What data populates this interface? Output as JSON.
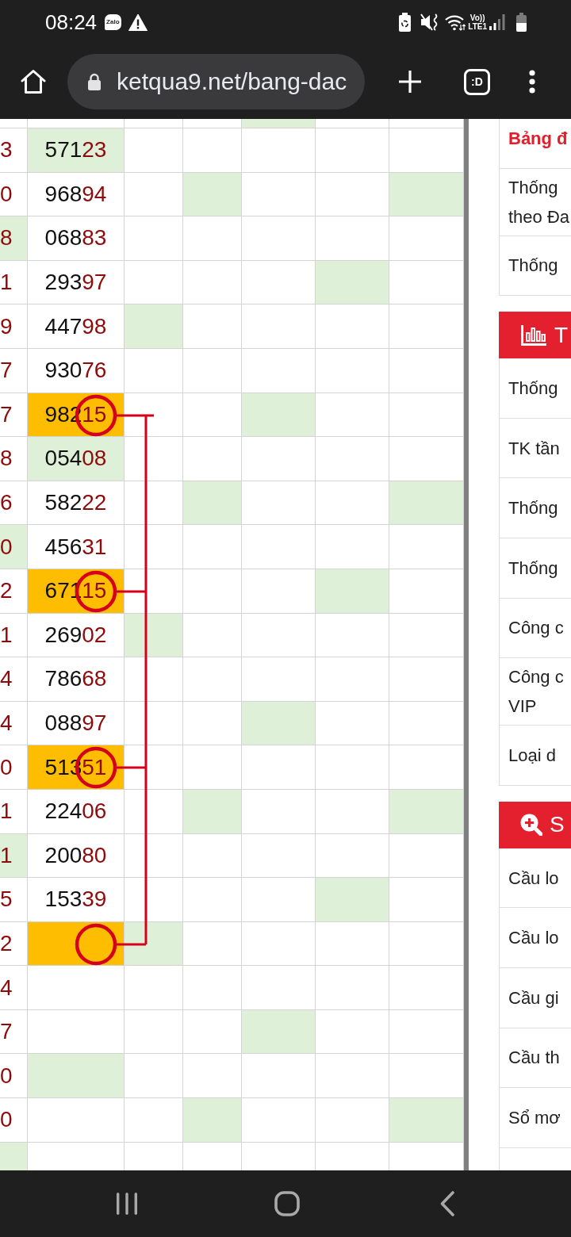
{
  "status_bar": {
    "time": "08:24",
    "notifications": [
      {
        "label": "Zalo"
      }
    ],
    "network": {
      "volte": "Vo))",
      "type": "LTE1"
    }
  },
  "browser": {
    "url": "ketqua9.net/bang-dac",
    "tab_count": ":D"
  },
  "table": {
    "rows": [
      {
        "digit_marked": false,
        "number": {
          "marked": false,
          "highlighted": false
        },
        "circled": false,
        "cells": [
          {
            "marked": false
          },
          {
            "marked": false
          },
          {
            "marked": true
          },
          {
            "marked": false
          },
          {
            "marked": false
          }
        ]
      },
      {
        "digit": "3",
        "digit_marked": false,
        "number": {
          "lead": "571",
          "tail": "23",
          "marked": true,
          "highlighted": false
        },
        "circled": false,
        "cells": [
          {
            "marked": false
          },
          {
            "marked": false
          },
          {
            "marked": false
          },
          {
            "marked": false
          },
          {
            "marked": false
          }
        ]
      },
      {
        "digit": "0",
        "digit_marked": false,
        "number": {
          "lead": "968",
          "tail": "94",
          "marked": false,
          "highlighted": false
        },
        "circled": false,
        "cells": [
          {
            "marked": false
          },
          {
            "marked": true
          },
          {
            "marked": false
          },
          {
            "marked": false
          },
          {
            "marked": true
          }
        ]
      },
      {
        "digit": "8",
        "digit_marked": true,
        "number": {
          "lead": "068",
          "tail": "83",
          "marked": false,
          "highlighted": false
        },
        "circled": false,
        "cells": [
          {
            "marked": false
          },
          {
            "marked": false
          },
          {
            "marked": false
          },
          {
            "marked": false
          },
          {
            "marked": false
          }
        ]
      },
      {
        "digit": "1",
        "digit_marked": false,
        "number": {
          "lead": "293",
          "tail": "97",
          "marked": false,
          "highlighted": false
        },
        "circled": false,
        "cells": [
          {
            "marked": false
          },
          {
            "marked": false
          },
          {
            "marked": false
          },
          {
            "marked": true
          },
          {
            "marked": false
          }
        ]
      },
      {
        "digit": "9",
        "digit_marked": false,
        "number": {
          "lead": "447",
          "tail": "98",
          "marked": false,
          "highlighted": false
        },
        "circled": false,
        "cells": [
          {
            "marked": true
          },
          {
            "marked": false
          },
          {
            "marked": false
          },
          {
            "marked": false
          },
          {
            "marked": false
          }
        ]
      },
      {
        "digit": "7",
        "digit_marked": false,
        "number": {
          "lead": "930",
          "tail": "76",
          "marked": false,
          "highlighted": false
        },
        "circled": false,
        "cells": [
          {
            "marked": false
          },
          {
            "marked": false
          },
          {
            "marked": false
          },
          {
            "marked": false
          },
          {
            "marked": false
          }
        ]
      },
      {
        "digit": "7",
        "digit_marked": false,
        "number": {
          "lead": "982",
          "tail": "15",
          "marked": false,
          "highlighted": true
        },
        "circled": true,
        "cells": [
          {
            "marked": false
          },
          {
            "marked": false
          },
          {
            "marked": true
          },
          {
            "marked": false
          },
          {
            "marked": false
          }
        ]
      },
      {
        "digit": "8",
        "digit_marked": false,
        "number": {
          "lead": "054",
          "tail": "08",
          "marked": true,
          "highlighted": false
        },
        "circled": false,
        "cells": [
          {
            "marked": false
          },
          {
            "marked": false
          },
          {
            "marked": false
          },
          {
            "marked": false
          },
          {
            "marked": false
          }
        ]
      },
      {
        "digit": "6",
        "digit_marked": false,
        "number": {
          "lead": "582",
          "tail": "22",
          "marked": false,
          "highlighted": false
        },
        "circled": false,
        "cells": [
          {
            "marked": false
          },
          {
            "marked": true
          },
          {
            "marked": false
          },
          {
            "marked": false
          },
          {
            "marked": true
          }
        ]
      },
      {
        "digit": "0",
        "digit_marked": true,
        "number": {
          "lead": "456",
          "tail": "31",
          "marked": false,
          "highlighted": false
        },
        "circled": false,
        "cells": [
          {
            "marked": false
          },
          {
            "marked": false
          },
          {
            "marked": false
          },
          {
            "marked": false
          },
          {
            "marked": false
          }
        ]
      },
      {
        "digit": "2",
        "digit_marked": false,
        "number": {
          "lead": "671",
          "tail": "15",
          "marked": false,
          "highlighted": true
        },
        "circled": true,
        "cells": [
          {
            "marked": false
          },
          {
            "marked": false
          },
          {
            "marked": false
          },
          {
            "marked": true
          },
          {
            "marked": false
          }
        ]
      },
      {
        "digit": "1",
        "digit_marked": false,
        "number": {
          "lead": "269",
          "tail": "02",
          "marked": false,
          "highlighted": false
        },
        "circled": false,
        "cells": [
          {
            "marked": true
          },
          {
            "marked": false
          },
          {
            "marked": false
          },
          {
            "marked": false
          },
          {
            "marked": false
          }
        ]
      },
      {
        "digit": "4",
        "digit_marked": false,
        "number": {
          "lead": "786",
          "tail": "68",
          "marked": false,
          "highlighted": false
        },
        "circled": false,
        "cells": [
          {
            "marked": false
          },
          {
            "marked": false
          },
          {
            "marked": false
          },
          {
            "marked": false
          },
          {
            "marked": false
          }
        ]
      },
      {
        "digit": "4",
        "digit_marked": false,
        "number": {
          "lead": "088",
          "tail": "97",
          "marked": false,
          "highlighted": false
        },
        "circled": false,
        "cells": [
          {
            "marked": false
          },
          {
            "marked": false
          },
          {
            "marked": true
          },
          {
            "marked": false
          },
          {
            "marked": false
          }
        ]
      },
      {
        "digit": "0",
        "digit_marked": false,
        "number": {
          "lead": "513",
          "tail": "51",
          "marked": false,
          "highlighted": true
        },
        "circled": true,
        "cells": [
          {
            "marked": false
          },
          {
            "marked": false
          },
          {
            "marked": false
          },
          {
            "marked": false
          },
          {
            "marked": false
          }
        ]
      },
      {
        "digit": "1",
        "digit_marked": false,
        "number": {
          "lead": "224",
          "tail": "06",
          "marked": false,
          "highlighted": false
        },
        "circled": false,
        "cells": [
          {
            "marked": false
          },
          {
            "marked": true
          },
          {
            "marked": false
          },
          {
            "marked": false
          },
          {
            "marked": true
          }
        ]
      },
      {
        "digit": "1",
        "digit_marked": true,
        "number": {
          "lead": "200",
          "tail": "80",
          "marked": false,
          "highlighted": false
        },
        "circled": false,
        "cells": [
          {
            "marked": false
          },
          {
            "marked": false
          },
          {
            "marked": false
          },
          {
            "marked": false
          },
          {
            "marked": false
          }
        ]
      },
      {
        "digit": "5",
        "digit_marked": false,
        "number": {
          "lead": "153",
          "tail": "39",
          "marked": false,
          "highlighted": false
        },
        "circled": false,
        "cells": [
          {
            "marked": false
          },
          {
            "marked": false
          },
          {
            "marked": false
          },
          {
            "marked": true
          },
          {
            "marked": false
          }
        ]
      },
      {
        "digit": "2",
        "digit_marked": false,
        "number": {
          "marked": false,
          "highlighted": true
        },
        "circled": true,
        "cells": [
          {
            "marked": true
          },
          {
            "marked": false
          },
          {
            "marked": false
          },
          {
            "marked": false
          },
          {
            "marked": false
          }
        ]
      },
      {
        "digit": "4",
        "digit_marked": false,
        "number": {
          "marked": false,
          "highlighted": false
        },
        "circled": false,
        "cells": [
          {
            "marked": false
          },
          {
            "marked": false
          },
          {
            "marked": false
          },
          {
            "marked": false
          },
          {
            "marked": false
          }
        ]
      },
      {
        "digit": "7",
        "digit_marked": false,
        "number": {
          "marked": false,
          "highlighted": false
        },
        "circled": false,
        "cells": [
          {
            "marked": false
          },
          {
            "marked": false
          },
          {
            "marked": true
          },
          {
            "marked": false
          },
          {
            "marked": false
          }
        ]
      },
      {
        "digit": "0",
        "digit_marked": false,
        "number": {
          "marked": true,
          "highlighted": false
        },
        "circled": false,
        "cells": [
          {
            "marked": false
          },
          {
            "marked": false
          },
          {
            "marked": false
          },
          {
            "marked": false
          },
          {
            "marked": false
          }
        ]
      },
      {
        "digit": "0",
        "digit_marked": false,
        "number": {
          "marked": false,
          "highlighted": false
        },
        "circled": false,
        "cells": [
          {
            "marked": false
          },
          {
            "marked": true
          },
          {
            "marked": false
          },
          {
            "marked": false
          },
          {
            "marked": true
          }
        ]
      },
      {
        "digit_marked": true,
        "number": {
          "marked": false,
          "highlighted": false
        },
        "circled": false,
        "cells": [
          {
            "marked": false
          },
          {
            "marked": false
          },
          {
            "marked": false
          },
          {
            "marked": false
          },
          {
            "marked": false
          }
        ]
      }
    ]
  },
  "sidebar": {
    "sections": [
      {
        "items": [
          {
            "label": "Bảng đ",
            "selected": true
          },
          {
            "label": "Thống\ntheo Đa",
            "selected": false
          },
          {
            "label": "Thống",
            "selected": false
          }
        ]
      },
      {
        "title": "T",
        "items": [
          {
            "label": "Thống",
            "selected": false
          },
          {
            "label": "TK tần",
            "selected": false
          },
          {
            "label": "Thống",
            "selected": false
          },
          {
            "label": "Thống",
            "selected": false
          },
          {
            "label": "Công c",
            "selected": false
          },
          {
            "label": "Công c\nVIP",
            "selected": false
          },
          {
            "label": "Loại d",
            "selected": false
          }
        ]
      },
      {
        "title": "S",
        "items": [
          {
            "label": "Cầu lo",
            "selected": false
          },
          {
            "label": "Cầu lo",
            "selected": false
          },
          {
            "label": "Cầu gi",
            "selected": false
          },
          {
            "label": "Cầu th",
            "selected": false
          },
          {
            "label": "Sổ mơ",
            "selected": false
          }
        ]
      }
    ]
  }
}
